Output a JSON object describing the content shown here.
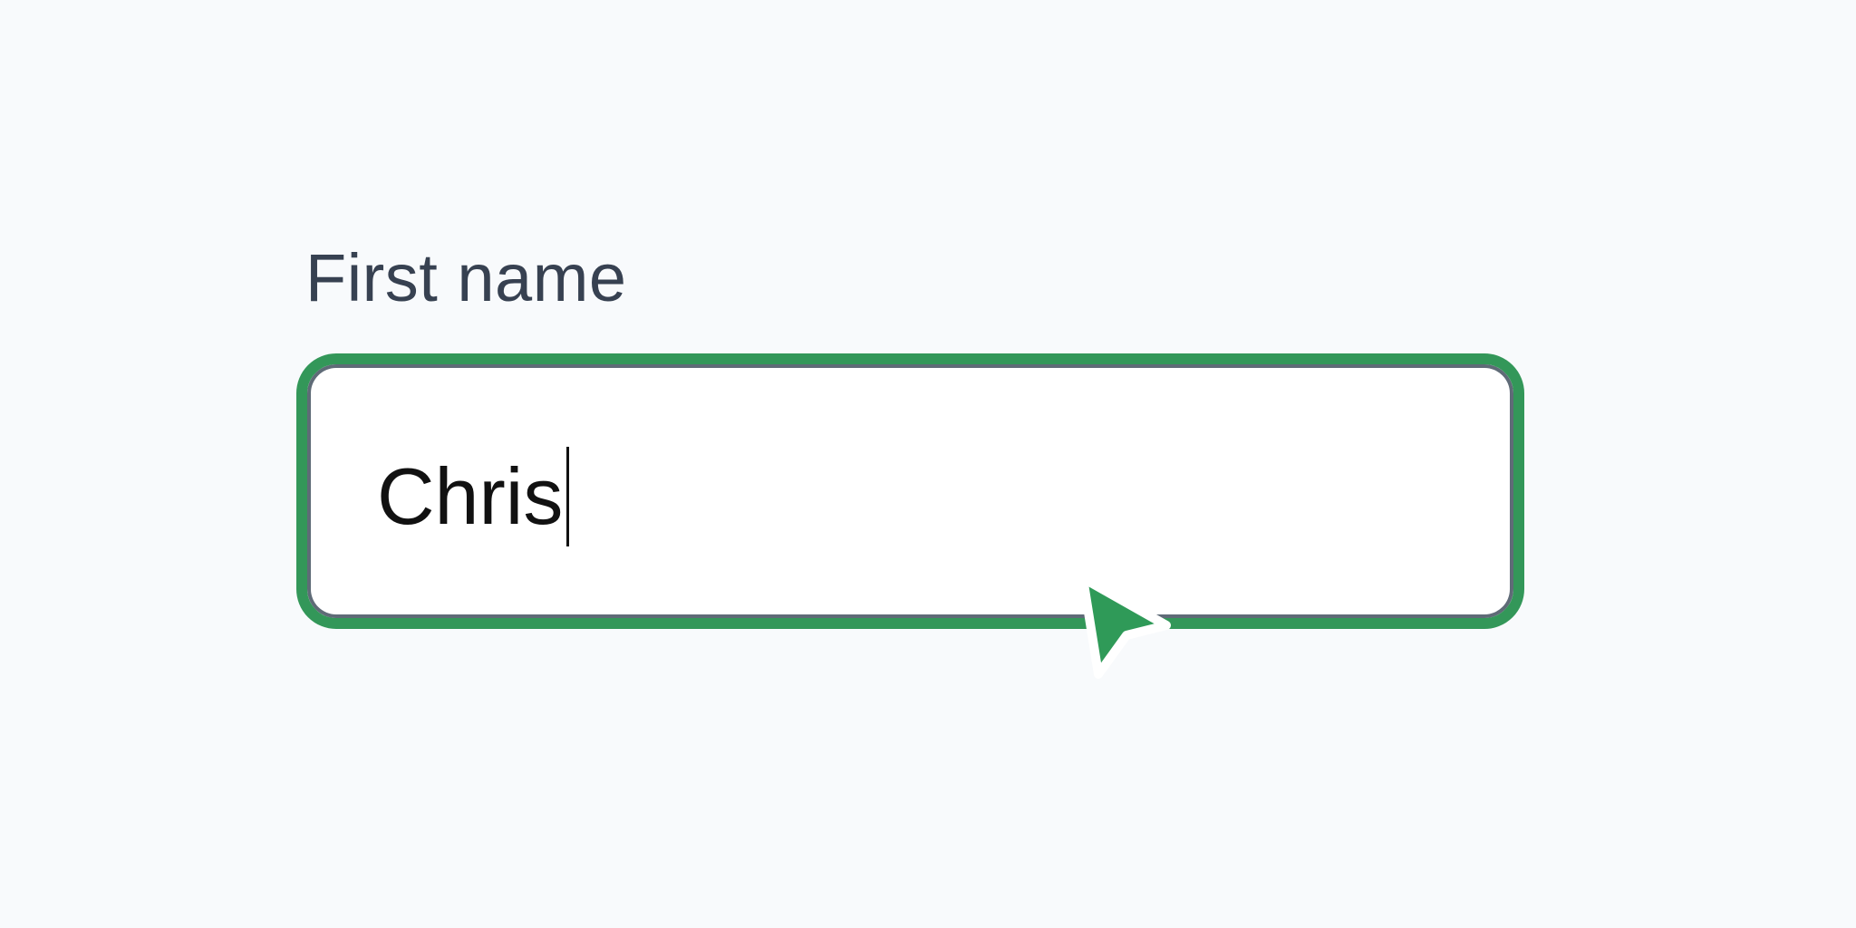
{
  "form": {
    "first_name": {
      "label": "First name",
      "value": "Chris"
    }
  },
  "colors": {
    "background": "#f8fafc",
    "focus_ring": "#339759",
    "input_border": "#5f6b77",
    "label_text": "#374151",
    "value_text": "#111111",
    "cursor_fill": "#2f9a58"
  },
  "icons": {
    "cursor": "mouse-pointer-icon"
  }
}
